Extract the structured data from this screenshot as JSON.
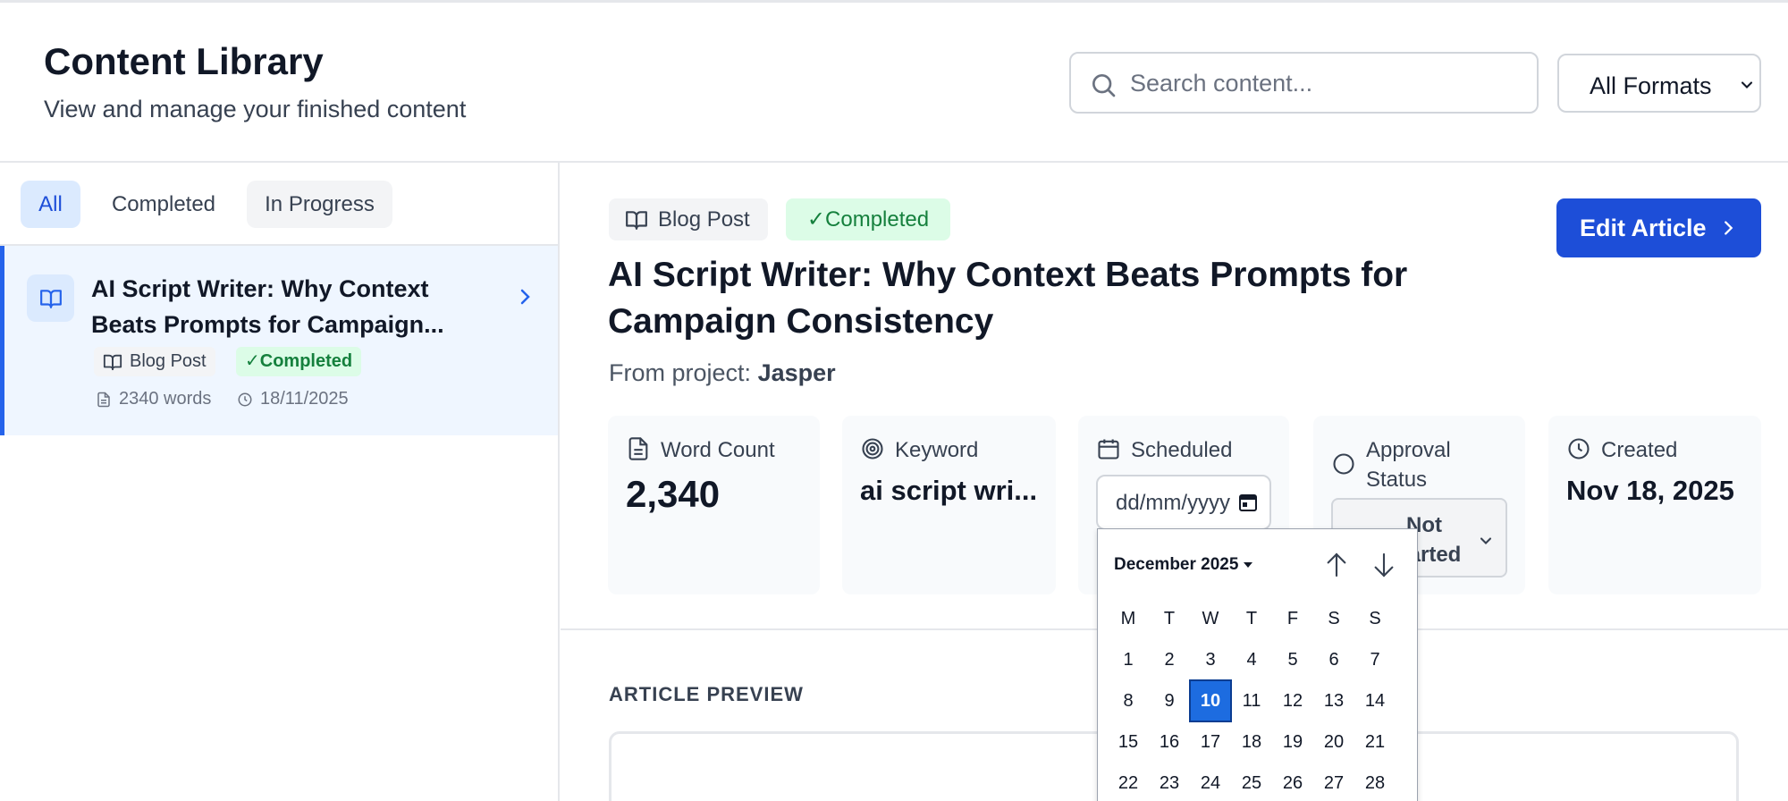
{
  "header": {
    "title": "Content Library",
    "subtitle": "View and manage your finished content",
    "search_placeholder": "Search content...",
    "format_filter": "All Formats"
  },
  "sidebar": {
    "filters": [
      "All",
      "Completed",
      "In Progress"
    ],
    "active_filter": "All",
    "items": [
      {
        "title": "AI Script Writer: Why Context Beats Prompts for Campaign...",
        "type": "Blog Post",
        "status": "✓Completed",
        "words": "2340 words",
        "date": "18/11/2025"
      }
    ]
  },
  "detail": {
    "type_badge": "Blog Post",
    "status_badge": "✓Completed",
    "edit_button": "Edit Article",
    "title": "AI Script Writer: Why Context Beats Prompts for Campaign Consistency",
    "from_project_label": "From project:",
    "project_name": "Jasper",
    "stats": {
      "word_count_label": "Word Count",
      "word_count_value": "2,340",
      "keyword_label": "Keyword",
      "keyword_value": "ai script wri...",
      "scheduled_label": "Scheduled",
      "scheduled_placeholder": "dd/mm/yyyy",
      "approval_label": "Approval Status",
      "approval_value": "Not Started",
      "created_label": "Created",
      "created_value": "Nov 18, 2025"
    },
    "preview_label": "ARTICLE PREVIEW"
  },
  "datepicker": {
    "month": "December 2025",
    "weekdays": [
      "M",
      "T",
      "W",
      "T",
      "F",
      "S",
      "S"
    ],
    "weeks": [
      [
        "1",
        "2",
        "3",
        "4",
        "5",
        "6",
        "7"
      ],
      [
        "8",
        "9",
        "10",
        "11",
        "12",
        "13",
        "14"
      ],
      [
        "15",
        "16",
        "17",
        "18",
        "19",
        "20",
        "21"
      ],
      [
        "22",
        "23",
        "24",
        "25",
        "26",
        "27",
        "28"
      ]
    ],
    "selected": "10"
  },
  "colors": {
    "accent": "#1d4ed8",
    "active_bg": "#eff6ff",
    "completed_bg": "#dcfce7",
    "completed_text": "#15803d"
  }
}
